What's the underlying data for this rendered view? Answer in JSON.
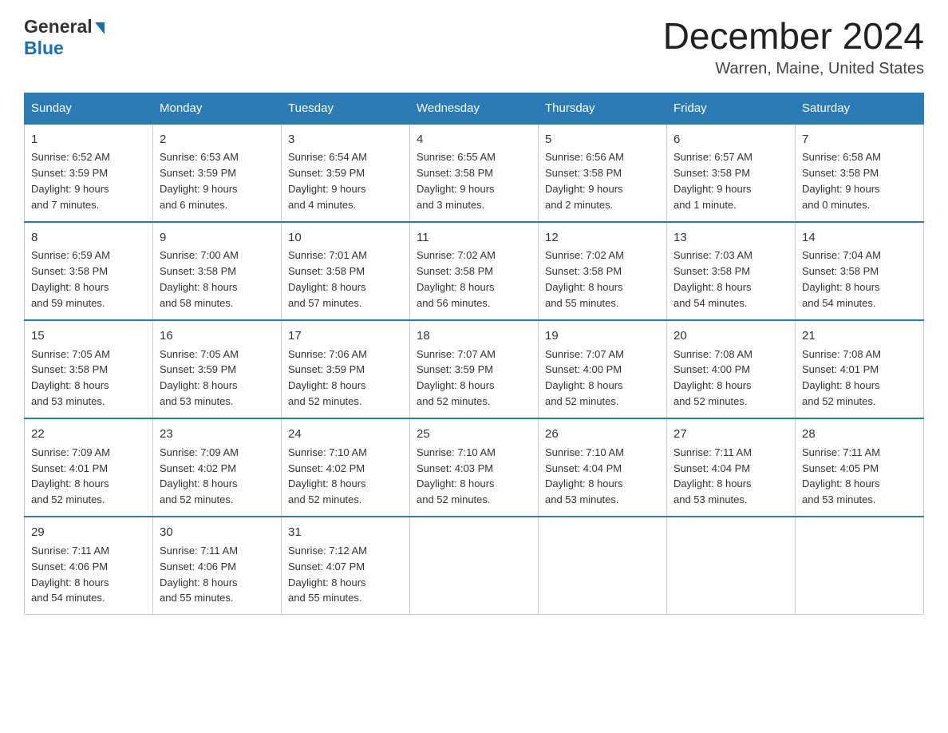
{
  "logo": {
    "line1": "General",
    "arrow": "▶",
    "line2": "Blue"
  },
  "header": {
    "month": "December 2024",
    "location": "Warren, Maine, United States"
  },
  "weekdays": [
    "Sunday",
    "Monday",
    "Tuesday",
    "Wednesday",
    "Thursday",
    "Friday",
    "Saturday"
  ],
  "weeks": [
    [
      {
        "day": 1,
        "info": "Sunrise: 6:52 AM\nSunset: 3:59 PM\nDaylight: 9 hours\nand 7 minutes."
      },
      {
        "day": 2,
        "info": "Sunrise: 6:53 AM\nSunset: 3:59 PM\nDaylight: 9 hours\nand 6 minutes."
      },
      {
        "day": 3,
        "info": "Sunrise: 6:54 AM\nSunset: 3:59 PM\nDaylight: 9 hours\nand 4 minutes."
      },
      {
        "day": 4,
        "info": "Sunrise: 6:55 AM\nSunset: 3:58 PM\nDaylight: 9 hours\nand 3 minutes."
      },
      {
        "day": 5,
        "info": "Sunrise: 6:56 AM\nSunset: 3:58 PM\nDaylight: 9 hours\nand 2 minutes."
      },
      {
        "day": 6,
        "info": "Sunrise: 6:57 AM\nSunset: 3:58 PM\nDaylight: 9 hours\nand 1 minute."
      },
      {
        "day": 7,
        "info": "Sunrise: 6:58 AM\nSunset: 3:58 PM\nDaylight: 9 hours\nand 0 minutes."
      }
    ],
    [
      {
        "day": 8,
        "info": "Sunrise: 6:59 AM\nSunset: 3:58 PM\nDaylight: 8 hours\nand 59 minutes."
      },
      {
        "day": 9,
        "info": "Sunrise: 7:00 AM\nSunset: 3:58 PM\nDaylight: 8 hours\nand 58 minutes."
      },
      {
        "day": 10,
        "info": "Sunrise: 7:01 AM\nSunset: 3:58 PM\nDaylight: 8 hours\nand 57 minutes."
      },
      {
        "day": 11,
        "info": "Sunrise: 7:02 AM\nSunset: 3:58 PM\nDaylight: 8 hours\nand 56 minutes."
      },
      {
        "day": 12,
        "info": "Sunrise: 7:02 AM\nSunset: 3:58 PM\nDaylight: 8 hours\nand 55 minutes."
      },
      {
        "day": 13,
        "info": "Sunrise: 7:03 AM\nSunset: 3:58 PM\nDaylight: 8 hours\nand 54 minutes."
      },
      {
        "day": 14,
        "info": "Sunrise: 7:04 AM\nSunset: 3:58 PM\nDaylight: 8 hours\nand 54 minutes."
      }
    ],
    [
      {
        "day": 15,
        "info": "Sunrise: 7:05 AM\nSunset: 3:58 PM\nDaylight: 8 hours\nand 53 minutes."
      },
      {
        "day": 16,
        "info": "Sunrise: 7:05 AM\nSunset: 3:59 PM\nDaylight: 8 hours\nand 53 minutes."
      },
      {
        "day": 17,
        "info": "Sunrise: 7:06 AM\nSunset: 3:59 PM\nDaylight: 8 hours\nand 52 minutes."
      },
      {
        "day": 18,
        "info": "Sunrise: 7:07 AM\nSunset: 3:59 PM\nDaylight: 8 hours\nand 52 minutes."
      },
      {
        "day": 19,
        "info": "Sunrise: 7:07 AM\nSunset: 4:00 PM\nDaylight: 8 hours\nand 52 minutes."
      },
      {
        "day": 20,
        "info": "Sunrise: 7:08 AM\nSunset: 4:00 PM\nDaylight: 8 hours\nand 52 minutes."
      },
      {
        "day": 21,
        "info": "Sunrise: 7:08 AM\nSunset: 4:01 PM\nDaylight: 8 hours\nand 52 minutes."
      }
    ],
    [
      {
        "day": 22,
        "info": "Sunrise: 7:09 AM\nSunset: 4:01 PM\nDaylight: 8 hours\nand 52 minutes."
      },
      {
        "day": 23,
        "info": "Sunrise: 7:09 AM\nSunset: 4:02 PM\nDaylight: 8 hours\nand 52 minutes."
      },
      {
        "day": 24,
        "info": "Sunrise: 7:10 AM\nSunset: 4:02 PM\nDaylight: 8 hours\nand 52 minutes."
      },
      {
        "day": 25,
        "info": "Sunrise: 7:10 AM\nSunset: 4:03 PM\nDaylight: 8 hours\nand 52 minutes."
      },
      {
        "day": 26,
        "info": "Sunrise: 7:10 AM\nSunset: 4:04 PM\nDaylight: 8 hours\nand 53 minutes."
      },
      {
        "day": 27,
        "info": "Sunrise: 7:11 AM\nSunset: 4:04 PM\nDaylight: 8 hours\nand 53 minutes."
      },
      {
        "day": 28,
        "info": "Sunrise: 7:11 AM\nSunset: 4:05 PM\nDaylight: 8 hours\nand 53 minutes."
      }
    ],
    [
      {
        "day": 29,
        "info": "Sunrise: 7:11 AM\nSunset: 4:06 PM\nDaylight: 8 hours\nand 54 minutes."
      },
      {
        "day": 30,
        "info": "Sunrise: 7:11 AM\nSunset: 4:06 PM\nDaylight: 8 hours\nand 55 minutes."
      },
      {
        "day": 31,
        "info": "Sunrise: 7:12 AM\nSunset: 4:07 PM\nDaylight: 8 hours\nand 55 minutes."
      },
      null,
      null,
      null,
      null
    ]
  ]
}
